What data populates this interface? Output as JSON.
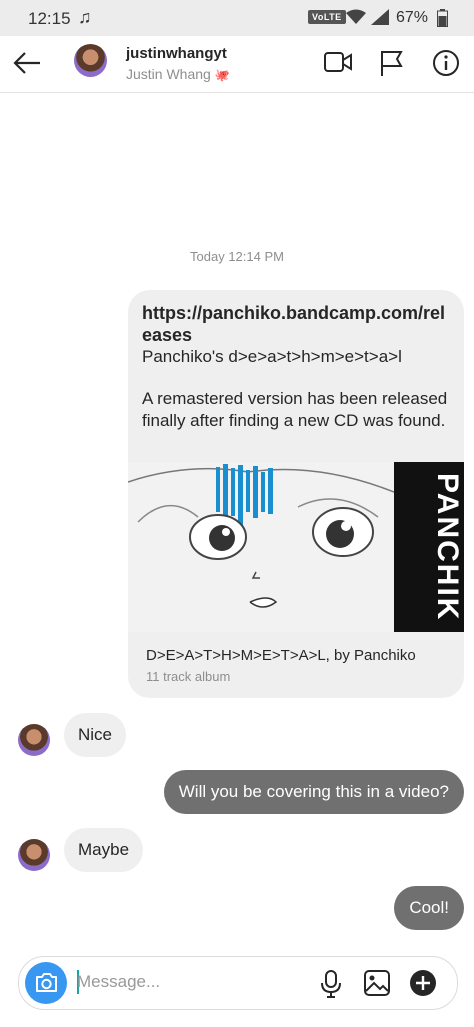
{
  "status": {
    "time": "12:15",
    "music_icon": "music-note-icon",
    "volte": "VoLTE",
    "battery": "67%"
  },
  "header": {
    "username": "justinwhangyt",
    "fullname": "Justin Whang",
    "emoji": "🐙",
    "icons": [
      "back-arrow-icon",
      "video-call-icon",
      "flag-icon",
      "info-icon"
    ]
  },
  "thread": {
    "timestamp": "Today 12:14 PM",
    "link_card": {
      "url": "https://panchiko.bandcamp.com/releases",
      "title": "Panchiko's d>e>a>t>h>m>e>t>a>l",
      "description": "A remastered version has been released finally after finding a new CD was found.",
      "image_text": "PANCHIK",
      "card_title": "D>E>A>T>H>M>E>T>A>L, by Panchiko",
      "card_subtitle": "11 track album"
    },
    "messages": [
      {
        "from": "them",
        "text": "Nice"
      },
      {
        "from": "me",
        "text": "Will you be covering this in a video?"
      },
      {
        "from": "them",
        "text": "Maybe"
      },
      {
        "from": "me",
        "text": "Cool!"
      }
    ]
  },
  "composer": {
    "placeholder": "Message...",
    "icons": [
      "camera-icon",
      "microphone-icon",
      "gallery-icon",
      "add-icon"
    ]
  },
  "colors": {
    "accent": "#3897f0",
    "outgoing_bubble": "#707070",
    "incoming_bubble": "#efefef"
  }
}
